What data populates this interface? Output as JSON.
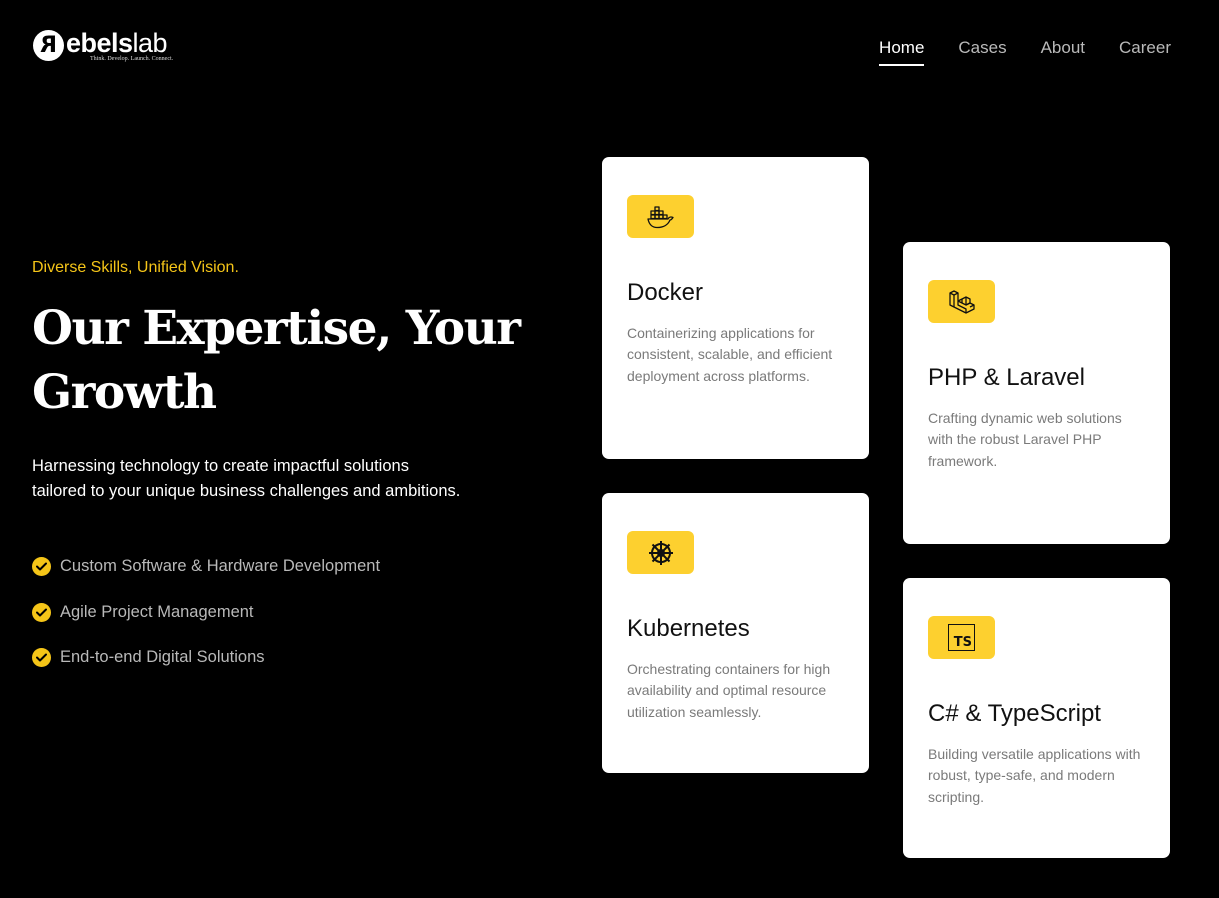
{
  "header": {
    "logo": {
      "mark": "R",
      "name_bold": "ebels",
      "name_light": "lab",
      "tagline": "Think. Develop. Launch. Connect."
    },
    "nav": [
      {
        "label": "Home",
        "active": true
      },
      {
        "label": "Cases",
        "active": false
      },
      {
        "label": "About",
        "active": false
      },
      {
        "label": "Career",
        "active": false
      }
    ]
  },
  "hero": {
    "eyebrow": "Diverse Skills, Unified Vision.",
    "headline_line1": "Our Expertise, Your",
    "headline_line2": "Growth",
    "subtext_line1": "Harnessing technology to create impactful solutions",
    "subtext_line2": "tailored to your unique business challenges and ambitions.",
    "features": [
      "Custom Software & Hardware Development",
      "Agile Project Management",
      "End-to-end Digital Solutions"
    ]
  },
  "cards": [
    {
      "icon": "docker-icon",
      "title": "Docker",
      "description": "Containerizing applications for consistent, scalable, and efficient deployment across platforms."
    },
    {
      "icon": "laravel-icon",
      "title": "PHP & Laravel",
      "description": "Crafting dynamic web solutions with the robust Laravel PHP framework."
    },
    {
      "icon": "kubernetes-icon",
      "title": "Kubernetes",
      "description": "Orchestrating containers for high availability and optimal resource utilization seamlessly."
    },
    {
      "icon": "typescript-icon",
      "icon_text": "TS",
      "title": "C# & TypeScript",
      "description": "Building versatile applications with robust, type-safe, and modern scripting."
    }
  ],
  "colors": {
    "accent": "#f5c518",
    "icon_background": "#fdd02f",
    "background": "#000000",
    "card_background": "#ffffff",
    "muted_text": "#b9b9b9"
  }
}
